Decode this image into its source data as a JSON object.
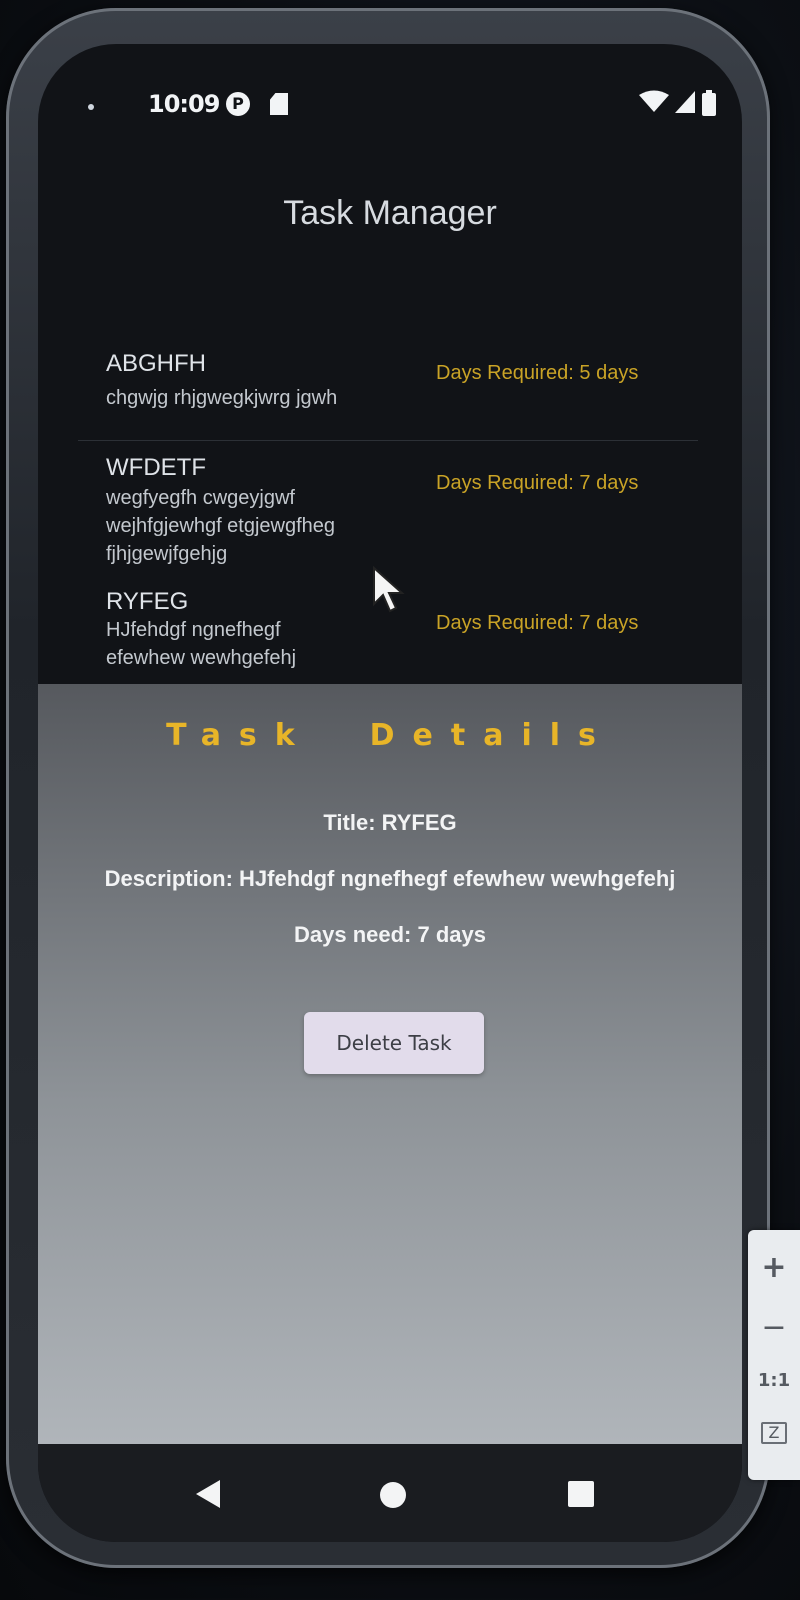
{
  "status_bar": {
    "time": "10:09",
    "icons": [
      "notification-dot-icon",
      "p-badge-icon",
      "sd-card-icon",
      "wifi-icon",
      "signal-icon",
      "battery-icon"
    ]
  },
  "app": {
    "title": "Task Manager"
  },
  "tasks": [
    {
      "title": "ABGHFH",
      "description": "chgwjg rhjgwegkjwrg jgwh",
      "days": "Days Required: 5 days"
    },
    {
      "title": "WFDETF",
      "description": "wegfyegfh cwgeyjgwf wejhfgjewhgf etgjewgfheg fjhjgewjfgehjg",
      "days": "Days Required: 7 days"
    },
    {
      "title": "RYFEG",
      "description": "HJfehdgf ngnefhegf efewhew wewhgefehj",
      "days": "Days Required: 7 days"
    }
  ],
  "details": {
    "heading": "Task  Details",
    "title_line": "Title: RYFEG",
    "description_line": "Description: HJfehdgf ngnefhegf efewhew wewhgefehj",
    "days_line": "Days need: 7 days",
    "delete_label": "Delete Task"
  },
  "zoom_panel": {
    "plus": "+",
    "minus": "−",
    "ratio": "1:1",
    "fit": "Z"
  },
  "colors": {
    "accent": "#e8b528",
    "days_text": "#c9a326",
    "button_bg": "#e2dceb",
    "screen_bg": "#111317"
  }
}
